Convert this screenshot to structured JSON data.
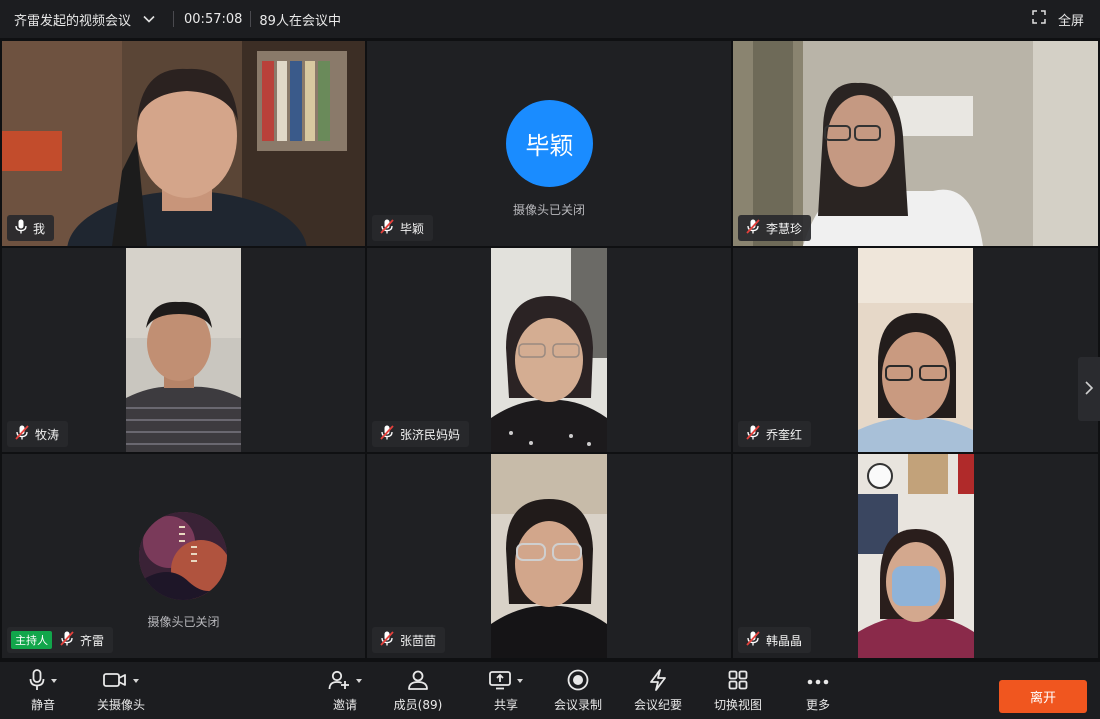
{
  "titlebar": {
    "meeting_title": "齐雷发起的视频会议",
    "elapsed": "00:57:08",
    "participants_status": "89人在会议中",
    "fullscreen_label": "全屏"
  },
  "camera_off_text": "摄像头已关闭",
  "host_label": "主持人",
  "participants": [
    {
      "name": "我",
      "mic": "on"
    },
    {
      "name": "毕颖",
      "mic": "muted",
      "avatar_text": "毕颖",
      "avatar_color": "#1a8cff"
    },
    {
      "name": "李慧珍",
      "mic": "muted"
    },
    {
      "name": "牧涛",
      "mic": "muted"
    },
    {
      "name": "张济民妈妈",
      "mic": "muted"
    },
    {
      "name": "乔奎红",
      "mic": "muted"
    },
    {
      "name": "齐雷",
      "mic": "muted",
      "role": "host"
    },
    {
      "name": "张茴茴",
      "mic": "muted"
    },
    {
      "name": "韩晶晶",
      "mic": "muted"
    }
  ],
  "toolbar": {
    "mute": "静音",
    "camera_off": "关摄像头",
    "invite": "邀请",
    "members": "成员(89)",
    "share": "共享",
    "record": "会议录制",
    "minutes": "会议纪要",
    "switch_view": "切换视图",
    "more": "更多",
    "leave": "离开"
  },
  "colors": {
    "accent_blue": "#1a8cff",
    "leave_orange": "#f0561f",
    "host_green": "#11a64b",
    "mute_red": "#e5413c"
  }
}
